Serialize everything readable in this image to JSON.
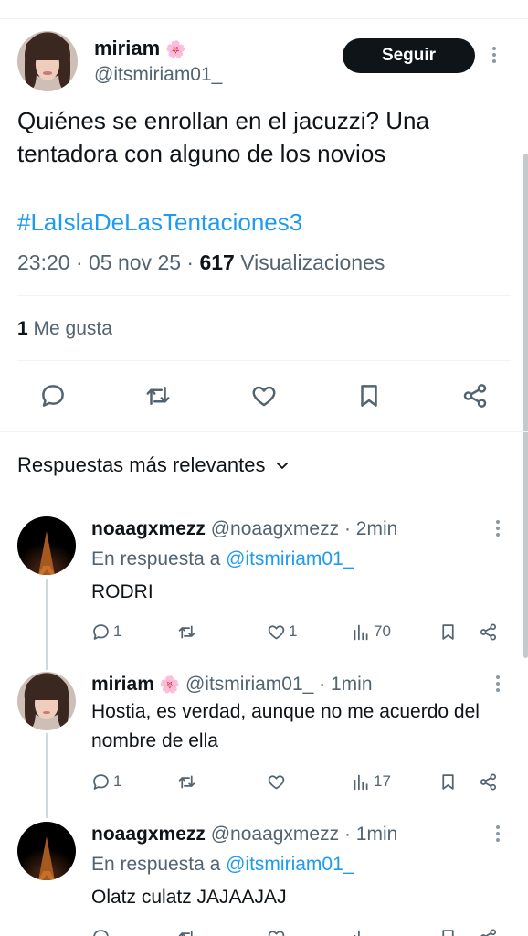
{
  "post": {
    "author": {
      "name": "miriam",
      "emoji": "🌸",
      "handle": "@itsmiriam01_"
    },
    "follow_label": "Seguir",
    "text": "Quiénes se enrollan en el jacuzzi? Una tentadora con alguno de los novios",
    "hashtag": "#LaIslaDeLasTentaciones3",
    "time": "23:20 · 05 nov 25 ·",
    "views_count": "617",
    "views_label": "Visualizaciones",
    "likes_count": "1",
    "likes_label": "Me gusta"
  },
  "sort_label": "Respuestas más relevantes",
  "replies": [
    {
      "name": "noaagxmezz",
      "handle": "@noaagxmezz · 2min",
      "in_reply_prefix": "En respuesta a",
      "in_reply_mention": "@itsmiriam01_",
      "text": "RODRI",
      "replies": "1",
      "reposts": "",
      "likes": "1",
      "views": "70"
    },
    {
      "name": "miriam",
      "emoji": "🌸",
      "handle": "@itsmiriam01_ · 1min",
      "text": "Hostia, es verdad, aunque no me acuerdo del nombre de ella",
      "replies": "1",
      "reposts": "",
      "likes": "",
      "views": "17"
    },
    {
      "name": "noaagxmezz",
      "handle": "@noaagxmezz · 1min",
      "in_reply_prefix": "En respuesta a",
      "in_reply_mention": "@itsmiriam01_",
      "text": "Olatz culatz JAJAAJAJ"
    }
  ]
}
